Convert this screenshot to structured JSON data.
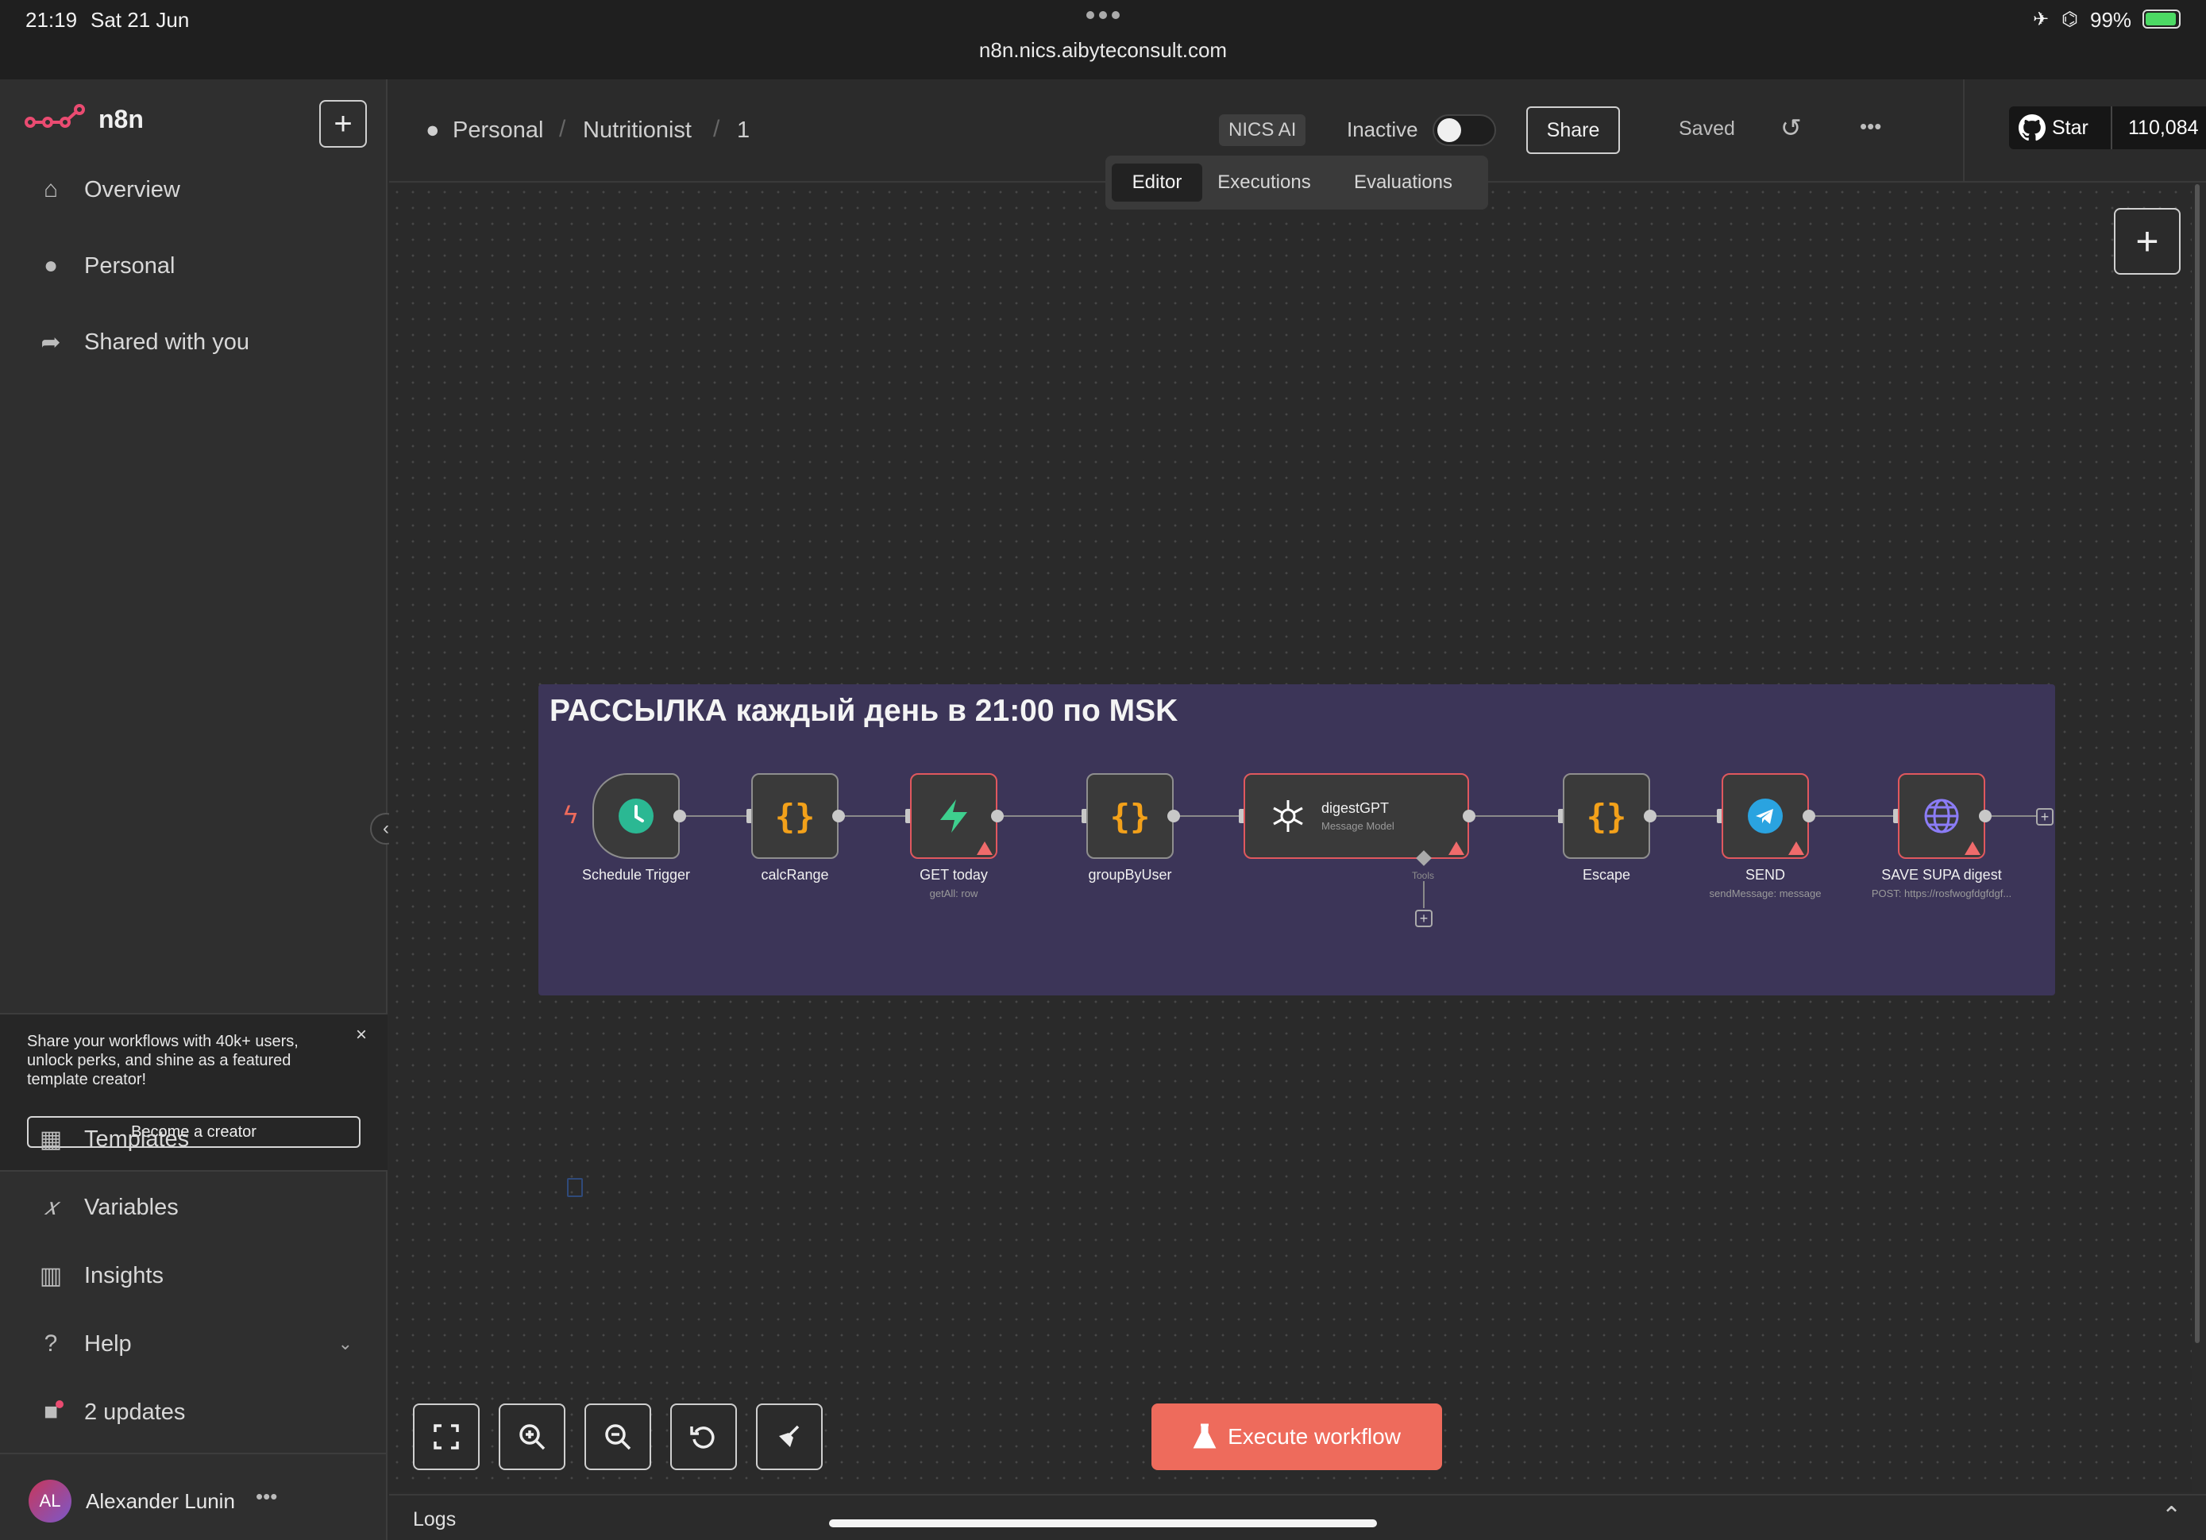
{
  "status_bar": {
    "time": "21:19",
    "date": "Sat 21 Jun",
    "battery": "99%",
    "url": "n8n.nics.aibyteconsult.com"
  },
  "sidebar": {
    "brand": "n8n",
    "nav": [
      {
        "label": "Overview",
        "icon": "home-icon"
      },
      {
        "label": "Personal",
        "icon": "user-icon"
      },
      {
        "label": "Shared with you",
        "icon": "share-icon"
      }
    ],
    "promo": {
      "text": "Share your workflows with 40k+ users, unlock perks, and shine as a featured template creator!",
      "button": "Become a creator"
    },
    "bottom_nav": [
      {
        "label": "Templates",
        "icon": "templates-icon"
      },
      {
        "label": "Variables",
        "icon": "variables-icon"
      },
      {
        "label": "Insights",
        "icon": "insights-icon"
      },
      {
        "label": "Help",
        "icon": "help-icon"
      },
      {
        "label": "2 updates",
        "icon": "gift-icon"
      }
    ],
    "user": {
      "initials": "AL",
      "name": "Alexander Lunin"
    }
  },
  "header": {
    "breadcrumb": [
      "Personal",
      "Nutritionist",
      "1"
    ],
    "tag": "NICS AI",
    "active_label": "Inactive",
    "share": "Share",
    "saved": "Saved",
    "github": {
      "star": "Star",
      "count": "110,084"
    },
    "tabs": [
      "Editor",
      "Executions",
      "Evaluations"
    ],
    "active_tab": "Editor"
  },
  "canvas": {
    "sticky_title": "РАССЫЛКА каждый день в 21:00 по MSK",
    "nodes": [
      {
        "name": "Schedule Trigger",
        "sub": "",
        "icon": "clock-icon"
      },
      {
        "name": "calcRange",
        "sub": "",
        "icon": "code-icon"
      },
      {
        "name": "GET today",
        "sub": "getAll: row",
        "icon": "supabase-icon"
      },
      {
        "name": "groupByUser",
        "sub": "",
        "icon": "code-icon"
      },
      {
        "name": "digestGPT",
        "sub": "Message Model",
        "icon": "openai-icon",
        "port_label": "Tools"
      },
      {
        "name": "Escape",
        "sub": "",
        "icon": "code-icon"
      },
      {
        "name": "SEND",
        "sub": "sendMessage: message",
        "icon": "telegram-icon"
      },
      {
        "name": "SAVE SUPA digest",
        "sub": "POST: https://rosfwogfdgfdgf...",
        "icon": "globe-icon"
      }
    ],
    "execute": "Execute workflow"
  },
  "logs": {
    "label": "Logs"
  },
  "colors": {
    "accent": "#ee6b5c",
    "sticky": "#3c3558",
    "warning": "#e0585e",
    "brand": "#ea4b71"
  }
}
